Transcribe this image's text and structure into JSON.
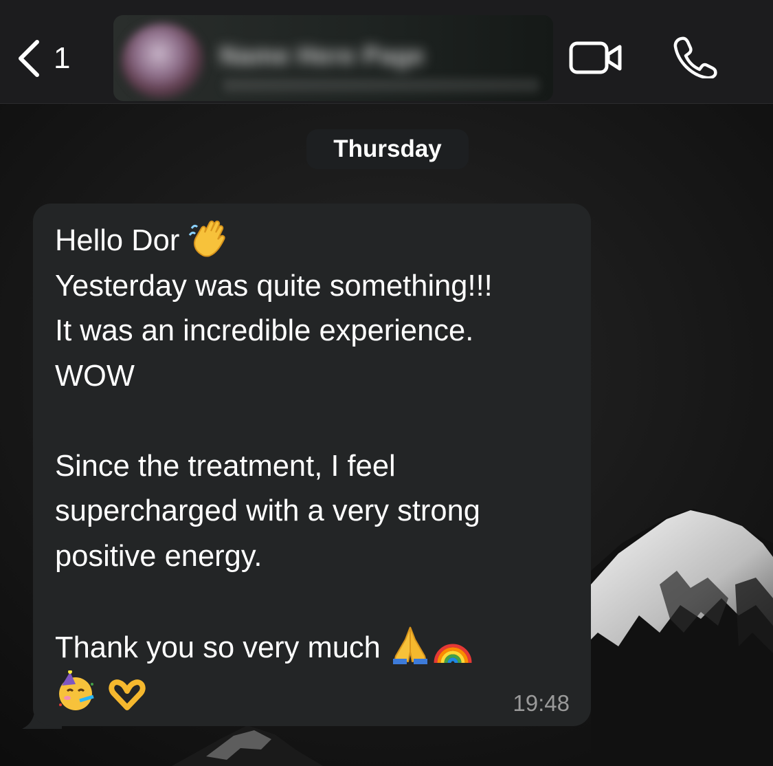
{
  "header": {
    "back_count": "1",
    "contact_name": "Name Here Page"
  },
  "chat": {
    "date_label": "Thursday",
    "message": {
      "lines": [
        "Hello Dor",
        "Yesterday was quite something!!!",
        "It was an incredible experience.",
        "WOW",
        "",
        "Since the treatment, I feel",
        "supercharged with a very strong",
        "positive energy.",
        "",
        "Thank you so very much"
      ],
      "emojis": [
        "waving-hand",
        "folded-hands",
        "rainbow",
        "partying-face",
        "heart-hands"
      ],
      "time": "19:48"
    }
  },
  "colors": {
    "header_bg": "#1c1c1e",
    "bubble_bg": "#232526",
    "text": "#ffffff",
    "time_text": "#9a9a9a"
  }
}
